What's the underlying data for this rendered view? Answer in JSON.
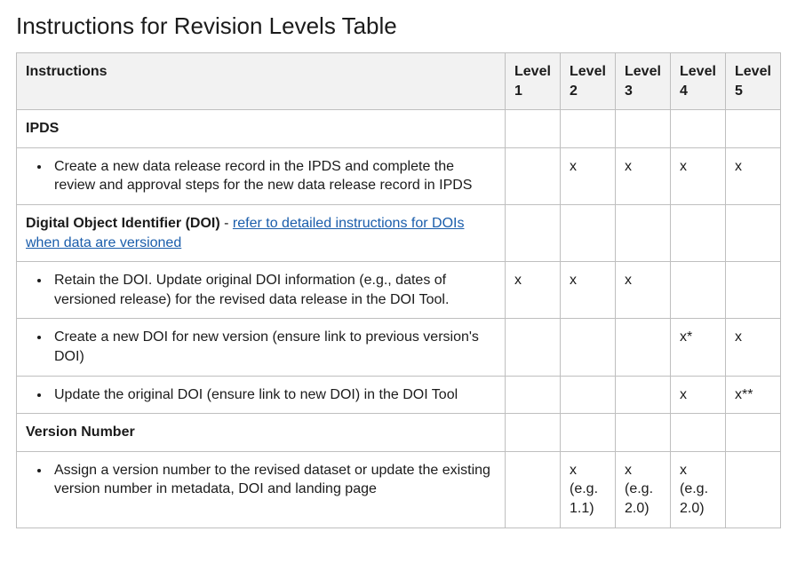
{
  "title": "Instructions for Revision Levels Table",
  "columns": {
    "instructions": "Instructions",
    "level1": "Level 1",
    "level2": "Level 2",
    "level3": "Level 3",
    "level4": "Level 4",
    "level5": "Level 5"
  },
  "sections": {
    "ipds": {
      "label": "IPDS",
      "row1": {
        "text": "Create a new data release record in the IPDS and complete the review and approval steps for the new data release record in IPDS",
        "l1": "",
        "l2": "x",
        "l3": "x",
        "l4": "x",
        "l5": "x"
      }
    },
    "doi": {
      "label_prefix": "Digital Object Identifier (DOI)",
      "dash": " - ",
      "link_text": "refer to detailed instructions for DOIs when data are versioned",
      "row1": {
        "text": "Retain the DOI. Update original DOI information (e.g., dates of versioned release) for the revised data release in the DOI Tool.",
        "l1": "x",
        "l2": "x",
        "l3": "x",
        "l4": "",
        "l5": ""
      },
      "row2": {
        "text": "Create a new DOI for new version (ensure link to previous version's DOI)",
        "l1": "",
        "l2": "",
        "l3": "",
        "l4": "x*",
        "l5": "x"
      },
      "row3": {
        "text": "Update the original DOI (ensure link to new DOI) in the DOI Tool",
        "l1": "",
        "l2": "",
        "l3": "",
        "l4": "x",
        "l5": "x**"
      }
    },
    "version": {
      "label": "Version Number",
      "row1": {
        "text": "Assign a version number to the revised dataset or update the existing version number in metadata, DOI and landing page",
        "l1": "",
        "l2": "x (e.g. 1.1)",
        "l3": "x (e.g. 2.0)",
        "l4": "x (e.g. 2.0)",
        "l5": ""
      }
    }
  }
}
